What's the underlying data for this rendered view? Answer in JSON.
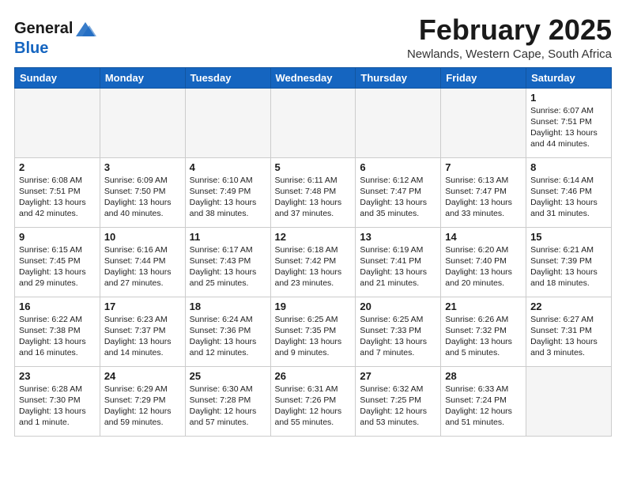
{
  "header": {
    "logo_line1": "General",
    "logo_line2": "Blue",
    "month": "February 2025",
    "location": "Newlands, Western Cape, South Africa"
  },
  "weekdays": [
    "Sunday",
    "Monday",
    "Tuesday",
    "Wednesday",
    "Thursday",
    "Friday",
    "Saturday"
  ],
  "weeks": [
    [
      {
        "day": "",
        "info": ""
      },
      {
        "day": "",
        "info": ""
      },
      {
        "day": "",
        "info": ""
      },
      {
        "day": "",
        "info": ""
      },
      {
        "day": "",
        "info": ""
      },
      {
        "day": "",
        "info": ""
      },
      {
        "day": "1",
        "info": "Sunrise: 6:07 AM\nSunset: 7:51 PM\nDaylight: 13 hours\nand 44 minutes."
      }
    ],
    [
      {
        "day": "2",
        "info": "Sunrise: 6:08 AM\nSunset: 7:51 PM\nDaylight: 13 hours\nand 42 minutes."
      },
      {
        "day": "3",
        "info": "Sunrise: 6:09 AM\nSunset: 7:50 PM\nDaylight: 13 hours\nand 40 minutes."
      },
      {
        "day": "4",
        "info": "Sunrise: 6:10 AM\nSunset: 7:49 PM\nDaylight: 13 hours\nand 38 minutes."
      },
      {
        "day": "5",
        "info": "Sunrise: 6:11 AM\nSunset: 7:48 PM\nDaylight: 13 hours\nand 37 minutes."
      },
      {
        "day": "6",
        "info": "Sunrise: 6:12 AM\nSunset: 7:47 PM\nDaylight: 13 hours\nand 35 minutes."
      },
      {
        "day": "7",
        "info": "Sunrise: 6:13 AM\nSunset: 7:47 PM\nDaylight: 13 hours\nand 33 minutes."
      },
      {
        "day": "8",
        "info": "Sunrise: 6:14 AM\nSunset: 7:46 PM\nDaylight: 13 hours\nand 31 minutes."
      }
    ],
    [
      {
        "day": "9",
        "info": "Sunrise: 6:15 AM\nSunset: 7:45 PM\nDaylight: 13 hours\nand 29 minutes."
      },
      {
        "day": "10",
        "info": "Sunrise: 6:16 AM\nSunset: 7:44 PM\nDaylight: 13 hours\nand 27 minutes."
      },
      {
        "day": "11",
        "info": "Sunrise: 6:17 AM\nSunset: 7:43 PM\nDaylight: 13 hours\nand 25 minutes."
      },
      {
        "day": "12",
        "info": "Sunrise: 6:18 AM\nSunset: 7:42 PM\nDaylight: 13 hours\nand 23 minutes."
      },
      {
        "day": "13",
        "info": "Sunrise: 6:19 AM\nSunset: 7:41 PM\nDaylight: 13 hours\nand 21 minutes."
      },
      {
        "day": "14",
        "info": "Sunrise: 6:20 AM\nSunset: 7:40 PM\nDaylight: 13 hours\nand 20 minutes."
      },
      {
        "day": "15",
        "info": "Sunrise: 6:21 AM\nSunset: 7:39 PM\nDaylight: 13 hours\nand 18 minutes."
      }
    ],
    [
      {
        "day": "16",
        "info": "Sunrise: 6:22 AM\nSunset: 7:38 PM\nDaylight: 13 hours\nand 16 minutes."
      },
      {
        "day": "17",
        "info": "Sunrise: 6:23 AM\nSunset: 7:37 PM\nDaylight: 13 hours\nand 14 minutes."
      },
      {
        "day": "18",
        "info": "Sunrise: 6:24 AM\nSunset: 7:36 PM\nDaylight: 13 hours\nand 12 minutes."
      },
      {
        "day": "19",
        "info": "Sunrise: 6:25 AM\nSunset: 7:35 PM\nDaylight: 13 hours\nand 9 minutes."
      },
      {
        "day": "20",
        "info": "Sunrise: 6:25 AM\nSunset: 7:33 PM\nDaylight: 13 hours\nand 7 minutes."
      },
      {
        "day": "21",
        "info": "Sunrise: 6:26 AM\nSunset: 7:32 PM\nDaylight: 13 hours\nand 5 minutes."
      },
      {
        "day": "22",
        "info": "Sunrise: 6:27 AM\nSunset: 7:31 PM\nDaylight: 13 hours\nand 3 minutes."
      }
    ],
    [
      {
        "day": "23",
        "info": "Sunrise: 6:28 AM\nSunset: 7:30 PM\nDaylight: 13 hours\nand 1 minute."
      },
      {
        "day": "24",
        "info": "Sunrise: 6:29 AM\nSunset: 7:29 PM\nDaylight: 12 hours\nand 59 minutes."
      },
      {
        "day": "25",
        "info": "Sunrise: 6:30 AM\nSunset: 7:28 PM\nDaylight: 12 hours\nand 57 minutes."
      },
      {
        "day": "26",
        "info": "Sunrise: 6:31 AM\nSunset: 7:26 PM\nDaylight: 12 hours\nand 55 minutes."
      },
      {
        "day": "27",
        "info": "Sunrise: 6:32 AM\nSunset: 7:25 PM\nDaylight: 12 hours\nand 53 minutes."
      },
      {
        "day": "28",
        "info": "Sunrise: 6:33 AM\nSunset: 7:24 PM\nDaylight: 12 hours\nand 51 minutes."
      },
      {
        "day": "",
        "info": ""
      }
    ]
  ]
}
